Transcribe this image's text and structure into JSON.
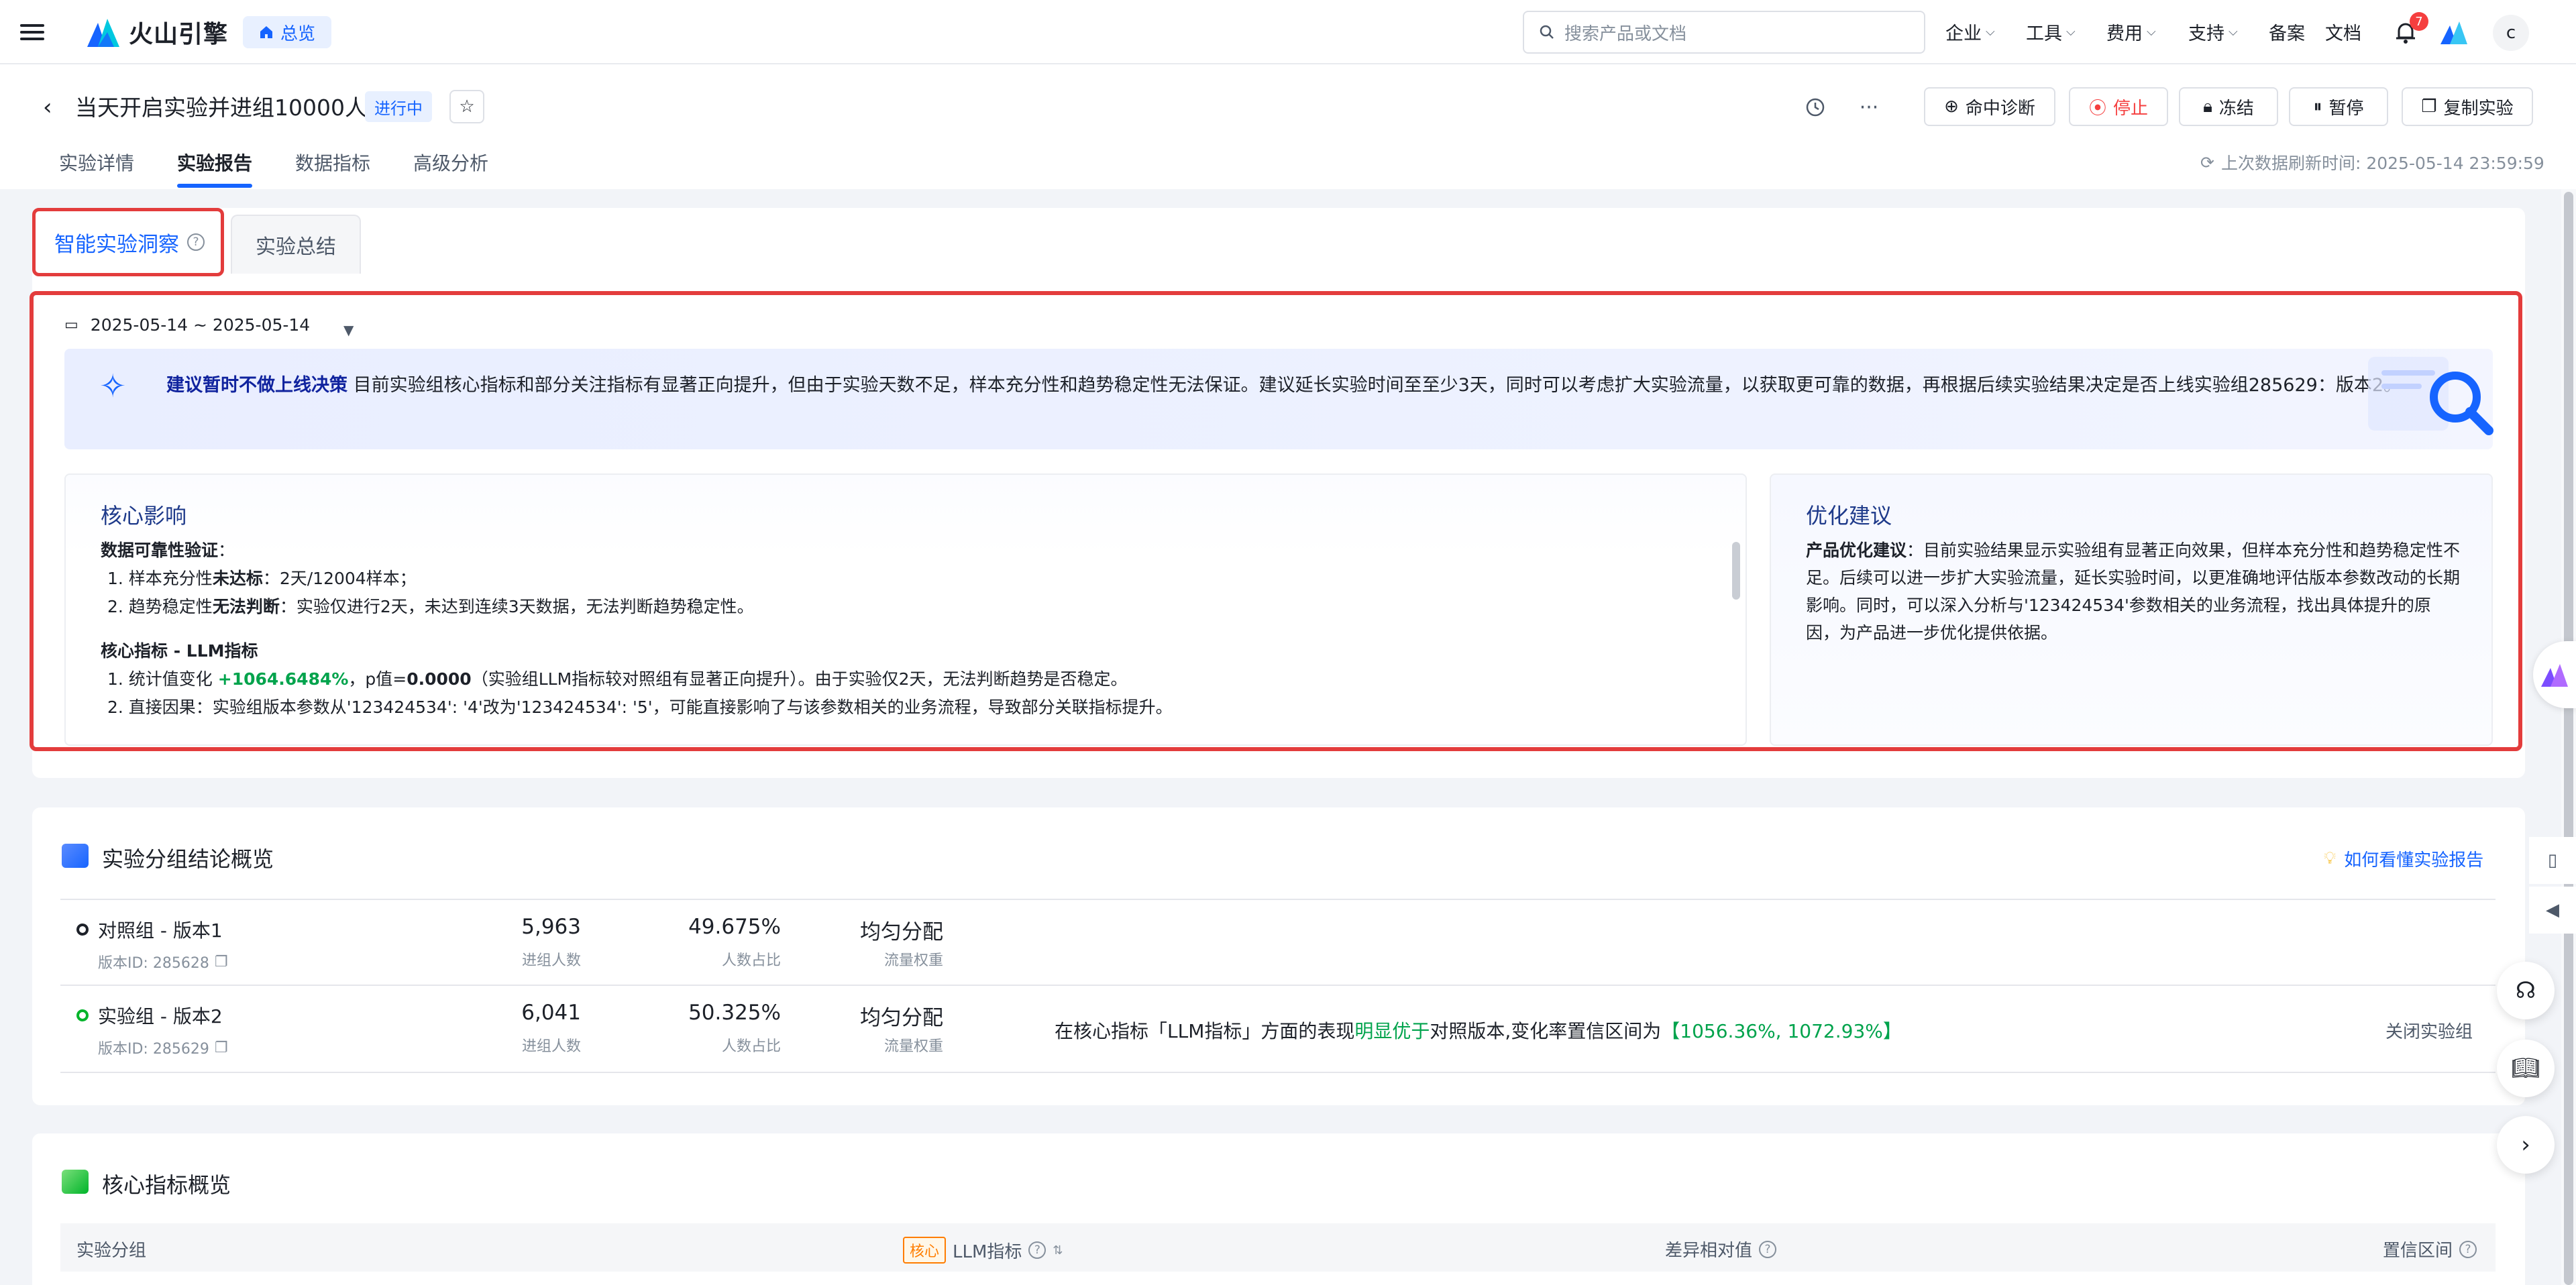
{
  "topnav": {
    "logo_text": "火山引擎",
    "overview": "总览",
    "search_placeholder": "搜索产品或文档",
    "items": [
      "企业",
      "工具",
      "费用",
      "支持",
      "备案",
      "文档"
    ],
    "notification_count": "7",
    "avatar_initial": "c"
  },
  "header": {
    "title": "当天开启实验并进组10000人",
    "status": "进行中",
    "actions": {
      "diagnose": "命中诊断",
      "stop": "停止",
      "freeze": "冻结",
      "pause": "暂停",
      "copy": "复制实验"
    },
    "tabs": [
      "实验详情",
      "实验报告",
      "数据指标",
      "高级分析"
    ],
    "refresh_time": "上次数据刷新时间: 2025-05-14 23:59:59"
  },
  "insight": {
    "subtabs": [
      "智能实验洞察",
      "实验总结"
    ],
    "date_range": "2025-05-14 ~ 2025-05-14",
    "advice_title": "建议暂时不做上线决策",
    "advice_body": " 目前实验组核心指标和部分关注指标有显著正向提升，但由于实验天数不足，样本充分性和趋势稳定性无法保证。建议延长实验时间至至少3天，同时可以考虑扩大实验流量，以获取更可靠的数据，再根据后续实验结果决定是否上线实验组285629：版本2。",
    "impact": {
      "title": "核心影响",
      "validity_heading": "数据可靠性验证",
      "v1_prefix": "1. 样本充分性",
      "v1_bold": "未达标",
      "v1_suffix": "：2天/12004样本；",
      "v2_prefix": "2. 趋势稳定性",
      "v2_bold": "无法判断",
      "v2_suffix": "：实验仅进行2天，未达到连续3天数据，无法判断趋势稳定性。",
      "metric_heading": "核心指标 - LLM指标",
      "m1_prefix": "1. 统计值变化 ",
      "m1_change": "+1064.6484%",
      "m1_mid": "，p值=",
      "m1_p": "0.0000",
      "m1_suffix": "（实验组LLM指标较对照组有显著正向提升）。由于实验仅2天，无法判断趋势是否稳定。",
      "m2": "2. 直接因果：实验组版本参数从'123424534': '4'改为'123424534': '5'，可能直接影响了与该参数相关的业务流程，导致部分关联指标提升。"
    },
    "suggest": {
      "title": "优化建议",
      "heading": "产品优化建议",
      "body": "：目前实验结果显示实验组有显著正向效果，但样本充分性和趋势稳定性不足。后续可以进一步扩大实验流量，延长实验时间，以更准确地评估版本参数改动的长期影响。同时，可以深入分析与'123424534'参数相关的业务流程，找出具体提升的原因，为产品进一步优化提供依据。"
    }
  },
  "conclusion": {
    "title": "实验分组结论概览",
    "help_link": "如何看懂实验报告",
    "rows": [
      {
        "name": "对照组 - 版本1",
        "version_id": "版本ID: 285628",
        "users": "5,963",
        "users_label": "进组人数",
        "ratio": "49.675%",
        "ratio_label": "人数占比",
        "weight": "均匀分配",
        "weight_label": "流量权重"
      },
      {
        "name": "实验组 - 版本2",
        "version_id": "版本ID: 285629",
        "users": "6,041",
        "users_label": "进组人数",
        "ratio": "50.325%",
        "ratio_label": "人数占比",
        "weight": "均匀分配",
        "weight_label": "流量权重"
      }
    ],
    "result_prefix": "在核心指标「LLM指标」方面的表现",
    "result_highlight": "明显优于",
    "result_mid": "对照版本,变化率置信区间为",
    "result_ci": "【1056.36%, 1072.93%】",
    "close_link": "关闭实验组"
  },
  "core": {
    "title": "核心指标概览",
    "col_group": "实验分组",
    "core_tag": "核心",
    "col_metric": "LLM指标",
    "col_diff": "差异相对值",
    "col_ci": "置信区间"
  },
  "colors": {
    "accent": "#1664ff",
    "highlight_border": "#e33c3c",
    "positive": "#00a34c",
    "stop": "#f53f3f",
    "core_tag": "#ff7d00"
  }
}
